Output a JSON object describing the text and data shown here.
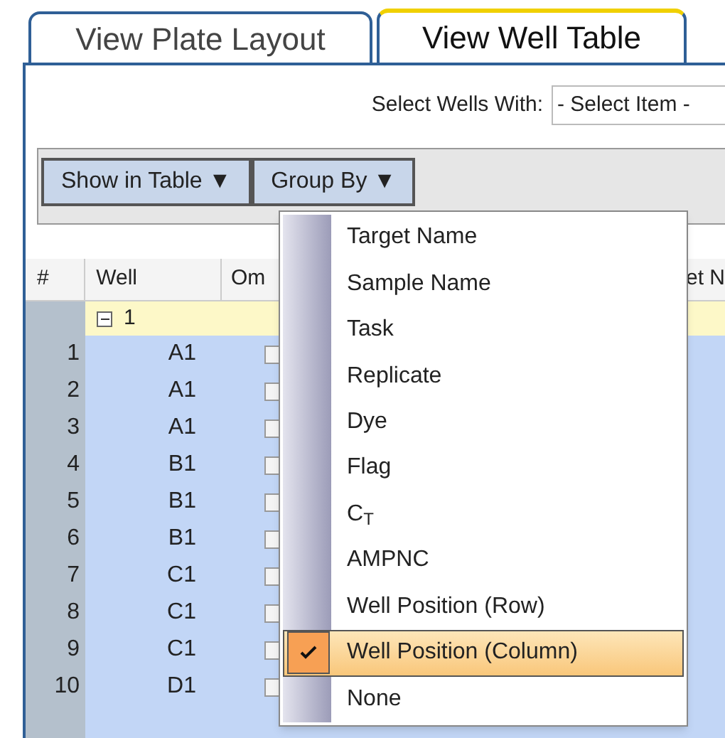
{
  "tabs": [
    {
      "label": "View Plate Layout",
      "selected": false
    },
    {
      "label": "View Well Table",
      "selected": true
    }
  ],
  "select_wells": {
    "label": "Select Wells With:",
    "value": "- Select Item -"
  },
  "toolbar": [
    {
      "label": "Show in Table ▼"
    },
    {
      "label": "Group By ▼"
    }
  ],
  "table": {
    "columns": [
      "#",
      "Well",
      "Om",
      "et N"
    ],
    "group": {
      "label": "1",
      "expanded": true
    },
    "rows": [
      {
        "num": "1",
        "well": "A1",
        "omit": false
      },
      {
        "num": "2",
        "well": "A1",
        "omit": false
      },
      {
        "num": "3",
        "well": "A1",
        "omit": false
      },
      {
        "num": "4",
        "well": "B1",
        "omit": false
      },
      {
        "num": "5",
        "well": "B1",
        "omit": false
      },
      {
        "num": "6",
        "well": "B1",
        "omit": false
      },
      {
        "num": "7",
        "well": "C1",
        "omit": false
      },
      {
        "num": "8",
        "well": "C1",
        "omit": false
      },
      {
        "num": "9",
        "well": "C1",
        "omit": false
      },
      {
        "num": "10",
        "well": "D1",
        "omit": false
      }
    ]
  },
  "menu": [
    {
      "label": "Target Name",
      "selected": false
    },
    {
      "label": "Sample Name",
      "selected": false
    },
    {
      "label": "Task",
      "selected": false
    },
    {
      "label": "Replicate",
      "selected": false
    },
    {
      "label": "Dye",
      "selected": false
    },
    {
      "label": "Flag",
      "selected": false
    },
    {
      "label": "C$_{T}$",
      "selected": false
    },
    {
      "label": "AMPNC",
      "selected": false
    },
    {
      "label": "Well Position (Row)",
      "selected": false
    },
    {
      "label": "Well Position (Column)",
      "selected": true
    },
    {
      "label": "None",
      "selected": false
    }
  ]
}
